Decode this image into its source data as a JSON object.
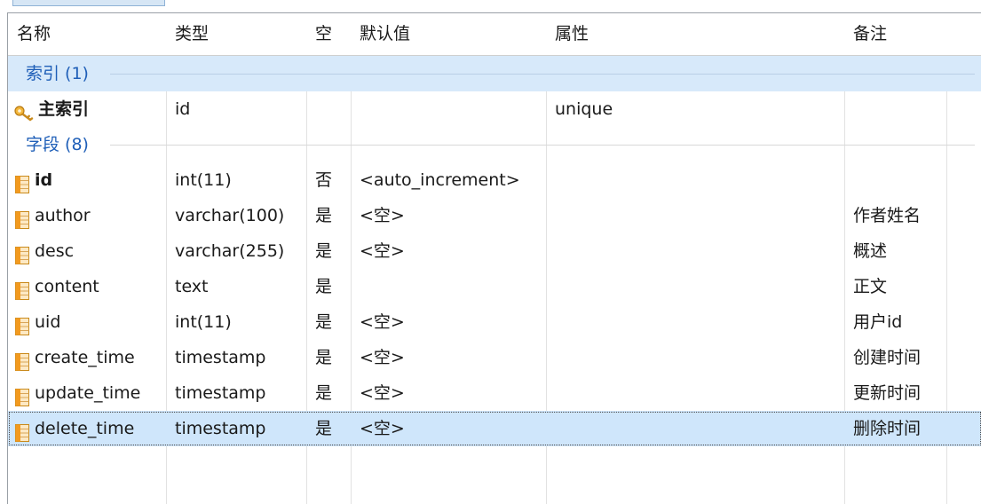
{
  "columns": {
    "name": "名称",
    "type": "类型",
    "null": "空",
    "default": "默认值",
    "attr": "属性",
    "comment": "备注"
  },
  "index_group": {
    "label": "索引 (1)",
    "items": [
      {
        "name": "主索引",
        "type": "id",
        "attr": "unique",
        "icon": "key-icon"
      }
    ]
  },
  "field_group": {
    "label": "字段 (8)",
    "items": [
      {
        "name": "id",
        "type": "int(11)",
        "null": "否",
        "default": "<auto_increment>",
        "comment": "",
        "bold": true,
        "icon": "column-icon"
      },
      {
        "name": "author",
        "type": "varchar(100)",
        "null": "是",
        "default": "<空>",
        "comment": "作者姓名",
        "icon": "column-icon"
      },
      {
        "name": "desc",
        "type": "varchar(255)",
        "null": "是",
        "default": "<空>",
        "comment": "概述",
        "icon": "column-icon"
      },
      {
        "name": "content",
        "type": "text",
        "null": "是",
        "default": "",
        "comment": "正文",
        "icon": "column-icon"
      },
      {
        "name": "uid",
        "type": "int(11)",
        "null": "是",
        "default": "<空>",
        "comment": "用户id",
        "icon": "column-icon"
      },
      {
        "name": "create_time",
        "type": "timestamp",
        "null": "是",
        "default": "<空>",
        "comment": "创建时间",
        "icon": "column-icon"
      },
      {
        "name": "update_time",
        "type": "timestamp",
        "null": "是",
        "default": "<空>",
        "comment": "更新时间",
        "icon": "column-icon"
      },
      {
        "name": "delete_time",
        "type": "timestamp",
        "null": "是",
        "default": "<空>",
        "comment": "删除时间",
        "selected": true,
        "icon": "column-icon"
      }
    ]
  },
  "colors": {
    "group_label": "#1f5fb8",
    "index_group_bg": "#d7e9fa",
    "selected_row_bg": "#cfe6fb",
    "column_icon": "#f0a030",
    "key_icon": "#e8a020"
  }
}
